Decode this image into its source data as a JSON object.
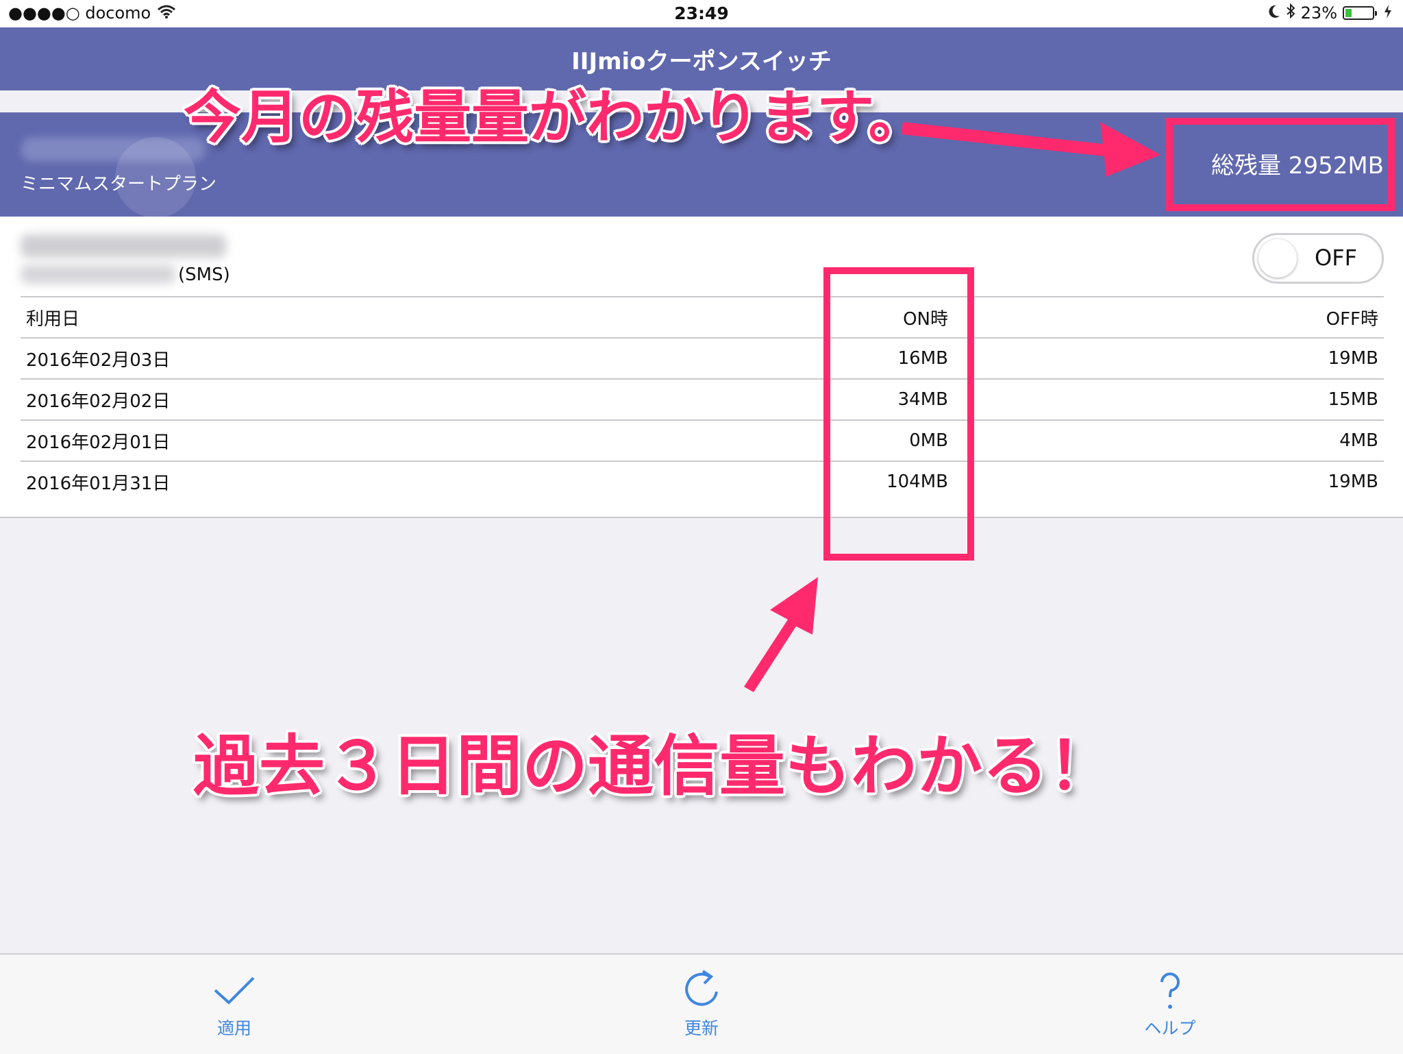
{
  "status_bar": {
    "carrier": "●●●●○ docomo",
    "time": "23:49",
    "battery_percent": "23%",
    "battery_level": 0.23,
    "icons": [
      "wifi-icon",
      "moon-icon",
      "bluetooth-icon",
      "battery-icon",
      "charging-icon"
    ]
  },
  "nav": {
    "title": "IIJmioクーポンスイッチ"
  },
  "plan": {
    "name": "ミニマムスタートプラン",
    "total_remaining": "総残量 2952MB"
  },
  "sim": {
    "type": "(SMS)",
    "toggle_label": "OFF",
    "toggle_on": false
  },
  "usage_table": {
    "headers": [
      "利用日",
      "ON時",
      "OFF時"
    ],
    "rows": [
      [
        "2016年02月03日",
        "16MB",
        "19MB"
      ],
      [
        "2016年02月02日",
        "34MB",
        "15MB"
      ],
      [
        "2016年02月01日",
        "0MB",
        "4MB"
      ],
      [
        "2016年01月31日",
        "104MB",
        "19MB"
      ]
    ]
  },
  "tab_bar": {
    "items": [
      {
        "label": "適用",
        "icon": "checkmark-icon"
      },
      {
        "label": "更新",
        "icon": "refresh-icon"
      },
      {
        "label": "ヘルプ",
        "icon": "question-icon"
      }
    ]
  },
  "annotations": {
    "remaining_note": "今月の残量量がわかります。",
    "history_note": "過去３日間の通信量もわかる！",
    "color": "#ff2a6d"
  },
  "colors": {
    "nav_bar": "#6068ae",
    "tab_tint": "#3f86e0",
    "battery": "#39c43b"
  }
}
